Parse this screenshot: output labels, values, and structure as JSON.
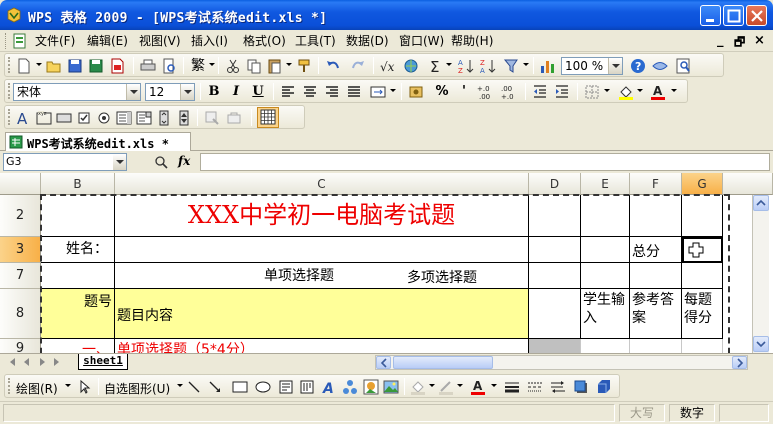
{
  "window": {
    "title": "WPS 表格 2009 - [WPS考试系统edit.xls *]",
    "title_bar_color": "#0a4fd8"
  },
  "menu": {
    "items": [
      "文件(F)",
      "编辑(E)",
      "视图(V)",
      "插入(I)",
      "格式(O)",
      "工具(T)",
      "数据(D)",
      "窗口(W)",
      "帮助(H)"
    ],
    "doc_controls": [
      "_",
      "🗗",
      "×"
    ]
  },
  "standard_toolbar": {
    "traditional_label": "繁",
    "zoom_value": "100 %"
  },
  "format_toolbar": {
    "font_name": "宋体",
    "font_size": "12",
    "bold_label": "B",
    "italic_label": "I",
    "underline_label": "U",
    "percent_label": "%",
    "comma_label": "'"
  },
  "document_tabs": [
    {
      "label": "WPS考试系统edit.xls *"
    }
  ],
  "formula_bar": {
    "name_box": "G3",
    "fx_label": "fx",
    "formula_value": ""
  },
  "grid": {
    "columns": [
      "B",
      "C",
      "D",
      "E",
      "F",
      "G"
    ],
    "selected_column": "G",
    "rows": [
      "2",
      "3",
      "7",
      "8",
      "9"
    ],
    "selected_row": "3",
    "title_cell": "XXX中学初一电脑考试题",
    "title_color": "#ee0000",
    "name_label": "姓名：",
    "total_label": "总分",
    "single_choice_header": "单项选择题",
    "multi_choice_header": "多项选择题",
    "question_no_header": "题号",
    "question_content_header": "题目内容",
    "student_input_header": "学生输入",
    "reference_answer_header": "参考答案",
    "score_per_header": "每题得分",
    "section_number": "一、",
    "section_title": "单项选择题（5*4分）",
    "header_fill": "#ffff99",
    "selection_color": "#f8b048"
  },
  "sheet_tabs": [
    {
      "label": "sheet1"
    }
  ],
  "drawing_toolbar": {
    "draw_label": "绘图(R)",
    "autoshape_label": "自选图形(U)"
  },
  "status_bar": {
    "caps": "大写",
    "num": "数字"
  }
}
